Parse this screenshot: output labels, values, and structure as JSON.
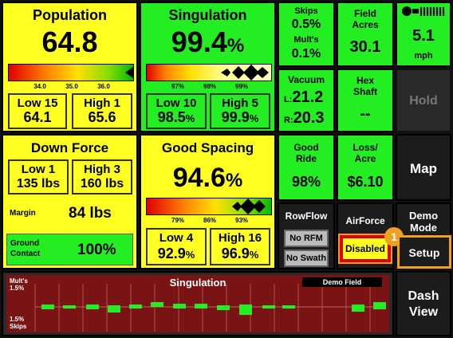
{
  "population": {
    "title": "Population",
    "value": "64.8",
    "ticks": [
      "34.0",
      "35.0",
      "36.0"
    ],
    "low": {
      "label": "Low 15",
      "value": "64.1"
    },
    "high": {
      "label": "High 1",
      "value": "65.6"
    }
  },
  "singulation": {
    "title": "Singulation",
    "value": "99.4",
    "unit": "%",
    "ticks": [
      "97%",
      "98%",
      "99%"
    ],
    "low": {
      "label": "Low 10",
      "value": "98.5",
      "unit": "%"
    },
    "high": {
      "label": "High 5",
      "value": "99.9",
      "unit": "%"
    }
  },
  "skips": {
    "label": "Skips",
    "value": "0.5%"
  },
  "mults": {
    "label": "Mult's",
    "value": "0.1%"
  },
  "field_acres": {
    "label": "Field\nAcres",
    "value": "30.1"
  },
  "speed": {
    "value": "5.1",
    "unit": "mph"
  },
  "vacuum": {
    "label": "Vacuum",
    "left_prefix": "L:",
    "left": "21.2",
    "right_prefix": "R:",
    "right": "20.3"
  },
  "hex_shaft": {
    "label": "Hex\nShaft",
    "value": "--"
  },
  "hold": {
    "label": "Hold"
  },
  "down_force": {
    "title": "Down Force",
    "low": {
      "label": "Low 1",
      "value": "135 lbs"
    },
    "high": {
      "label": "High 3",
      "value": "160 lbs"
    },
    "margin": {
      "label": "Margin",
      "value": "84 lbs"
    },
    "ground": {
      "label": "Ground\nContact",
      "value": "100%"
    }
  },
  "good_spacing": {
    "title": "Good Spacing",
    "value": "94.6",
    "unit": "%",
    "ticks": [
      "79%",
      "86%",
      "93%"
    ],
    "low": {
      "label": "Low 4",
      "value": "92.9",
      "unit": "%"
    },
    "high": {
      "label": "High 16",
      "value": "96.9",
      "unit": "%"
    }
  },
  "good_ride": {
    "label": "Good\nRide",
    "value": "98%"
  },
  "loss_acre": {
    "label": "Loss/\nAcre",
    "value": "$6.10"
  },
  "map": {
    "label": "Map"
  },
  "rowflow": {
    "title": "RowFlow",
    "btn1": "No RFM",
    "btn2": "No Swath"
  },
  "airforce": {
    "title": "AirForce",
    "status": "Disabled"
  },
  "demo_mode": {
    "label": "Demo\nMode"
  },
  "badge": {
    "number": "1"
  },
  "setup": {
    "label": "Setup"
  },
  "chart": {
    "title": "Singulation",
    "field": "Demo Field",
    "top_label": "Mult's\n1.5%",
    "bottom_label": "1.5%\nSkips"
  },
  "dash_view": {
    "label": "Dash\nView"
  },
  "colors": {
    "yellow": "#ffff22",
    "green": "#22ee22",
    "dark": "#1c1c1c",
    "chart_bg": "#7a1414",
    "badge": "#f0a020"
  }
}
